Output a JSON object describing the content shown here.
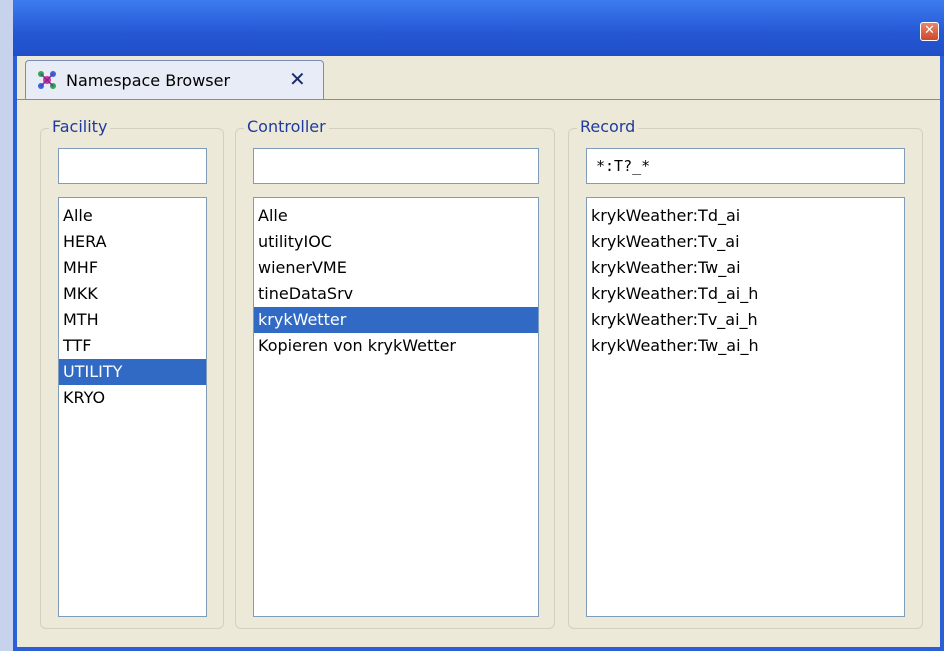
{
  "window": {
    "close_symbol": "✕"
  },
  "tab": {
    "icon": "namespace-browser-icon",
    "label": "Namespace Browser",
    "close_symbol": "✕"
  },
  "facility": {
    "label": "Facility",
    "filter_value": "",
    "items": [
      {
        "label": "Alle",
        "selected": false
      },
      {
        "label": "HERA",
        "selected": false
      },
      {
        "label": "MHF",
        "selected": false
      },
      {
        "label": "MKK",
        "selected": false
      },
      {
        "label": "MTH",
        "selected": false
      },
      {
        "label": "TTF",
        "selected": false
      },
      {
        "label": "UTILITY",
        "selected": true
      },
      {
        "label": "KRYO",
        "selected": false
      }
    ]
  },
  "controller": {
    "label": "Controller",
    "filter_value": "",
    "items": [
      {
        "label": "Alle",
        "selected": false
      },
      {
        "label": "utilityIOC",
        "selected": false
      },
      {
        "label": "wienerVME",
        "selected": false
      },
      {
        "label": "tineDataSrv",
        "selected": false
      },
      {
        "label": "krykWetter",
        "selected": true
      },
      {
        "label": "Kopieren von krykWetter",
        "selected": false
      }
    ]
  },
  "record": {
    "label": "Record",
    "filter_value": "*:T?_*",
    "items": [
      {
        "label": "krykWeather:Td_ai",
        "selected": false
      },
      {
        "label": "krykWeather:Tv_ai",
        "selected": false
      },
      {
        "label": "krykWeather:Tw_ai",
        "selected": false
      },
      {
        "label": "krykWeather:Td_ai_h",
        "selected": false
      },
      {
        "label": "krykWeather:Tv_ai_h",
        "selected": false
      },
      {
        "label": "krykWeather:Tw_ai_h",
        "selected": false
      }
    ]
  },
  "colors": {
    "titlebar": "#2557d3",
    "selection": "#316ac5",
    "group_label": "#1f3aa0",
    "dialog_bg": "#ece9d8"
  }
}
